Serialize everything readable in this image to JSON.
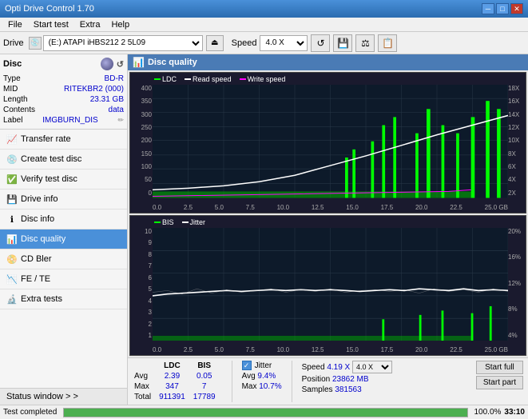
{
  "app": {
    "title": "Opti Drive Control 1.70",
    "version": "1.70"
  },
  "titlebar": {
    "title": "Opti Drive Control 1.70",
    "minimize": "─",
    "maximize": "□",
    "close": "✕"
  },
  "menubar": {
    "items": [
      "File",
      "Start test",
      "Extra",
      "Help"
    ]
  },
  "toolbar": {
    "drive_label": "Drive",
    "drive_value": "(E:) ATAPI iHBS212 2 5L09",
    "speed_label": "Speed",
    "speed_value": "4.0 X"
  },
  "disc_info": {
    "header": "Disc",
    "type_label": "Type",
    "type_value": "BD-R",
    "mid_label": "MID",
    "mid_value": "RITEKBR2 (000)",
    "length_label": "Length",
    "length_value": "23.31 GB",
    "contents_label": "Contents",
    "contents_value": "data",
    "label_label": "Label",
    "label_value": "IMGBURN_DIS"
  },
  "nav": {
    "items": [
      {
        "id": "transfer-rate",
        "label": "Transfer rate",
        "active": false
      },
      {
        "id": "create-test-disc",
        "label": "Create test disc",
        "active": false
      },
      {
        "id": "verify-test-disc",
        "label": "Verify test disc",
        "active": false
      },
      {
        "id": "drive-info",
        "label": "Drive info",
        "active": false
      },
      {
        "id": "disc-info",
        "label": "Disc info",
        "active": false
      },
      {
        "id": "disc-quality",
        "label": "Disc quality",
        "active": true
      },
      {
        "id": "cd-bler",
        "label": "CD Bler",
        "active": false
      },
      {
        "id": "fe-te",
        "label": "FE / TE",
        "active": false
      },
      {
        "id": "extra-tests",
        "label": "Extra tests",
        "active": false
      }
    ],
    "status_window": "Status window > >"
  },
  "chart1": {
    "title": "Disc quality",
    "legend": [
      {
        "label": "LDC",
        "color": "#00ff00"
      },
      {
        "label": "Read speed",
        "color": "#ffffff"
      },
      {
        "label": "Write speed",
        "color": "#ff00ff"
      }
    ],
    "y_labels_left": [
      "400",
      "350",
      "300",
      "250",
      "200",
      "150",
      "100",
      "50",
      "0"
    ],
    "y_labels_right": [
      "18X",
      "16X",
      "14X",
      "12X",
      "10X",
      "8X",
      "6X",
      "4X",
      "2X"
    ],
    "x_labels": [
      "0.0",
      "2.5",
      "5.0",
      "7.5",
      "10.0",
      "12.5",
      "15.0",
      "17.5",
      "20.0",
      "22.5",
      "25.0 GB"
    ]
  },
  "chart2": {
    "legend": [
      {
        "label": "BIS",
        "color": "#00ff00"
      },
      {
        "label": "Jitter",
        "color": "#ffffff"
      }
    ],
    "y_labels_left": [
      "10",
      "9",
      "8",
      "7",
      "6",
      "5",
      "4",
      "3",
      "2",
      "1"
    ],
    "y_labels_right": [
      "20%",
      "16%",
      "12%",
      "8%",
      "4%"
    ],
    "x_labels": [
      "0.0",
      "2.5",
      "5.0",
      "7.5",
      "10.0",
      "12.5",
      "15.0",
      "17.5",
      "20.0",
      "22.5",
      "25.0 GB"
    ]
  },
  "stats": {
    "columns": [
      "LDC",
      "BIS"
    ],
    "rows": [
      {
        "label": "Avg",
        "ldc": "2.39",
        "bis": "0.05"
      },
      {
        "label": "Max",
        "ldc": "347",
        "bis": "7"
      },
      {
        "label": "Total",
        "ldc": "911391",
        "bis": "17789"
      }
    ],
    "jitter": {
      "label": "Jitter",
      "avg": "9.4%",
      "max": "10.7%"
    },
    "speed": {
      "label": "Speed",
      "value": "4.19 X",
      "setting": "4.0 X"
    },
    "position": {
      "label": "Position",
      "value": "23862 MB",
      "samples_label": "Samples",
      "samples_value": "381563"
    },
    "buttons": {
      "start_full": "Start full",
      "start_part": "Start part"
    }
  },
  "statusbar": {
    "status_text": "Test completed",
    "progress": 100,
    "time": "33:10"
  }
}
